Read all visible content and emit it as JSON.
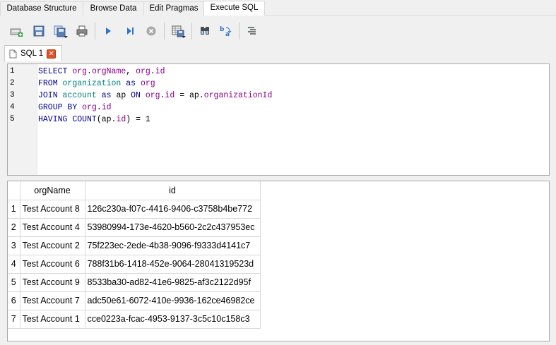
{
  "main_tabs": [
    {
      "label": "Database Structure",
      "active": false
    },
    {
      "label": "Browse Data",
      "active": false
    },
    {
      "label": "Edit Pragmas",
      "active": false
    },
    {
      "label": "Execute SQL",
      "active": true
    }
  ],
  "toolbar": {
    "icons": [
      "open-tab-icon",
      "open-sql-file-icon",
      "save-sql-file-icon",
      "print-icon",
      "execute-all-icon",
      "execute-line-icon",
      "stop-execution-icon",
      "save-results-icon",
      "find-icon",
      "find-replace-icon",
      "comment-icon"
    ]
  },
  "sql_tab": {
    "label": "SQL 1",
    "close_glyph": "✕"
  },
  "editor": {
    "line_numbers": [
      "1",
      "2",
      "3",
      "4",
      "5"
    ],
    "lines": [
      [
        {
          "t": "SELECT",
          "c": "kw"
        },
        {
          "t": " ",
          "c": "plain"
        },
        {
          "t": "org",
          "c": "col"
        },
        {
          "t": ".",
          "c": "plain"
        },
        {
          "t": "orgName",
          "c": "col"
        },
        {
          "t": ", ",
          "c": "plain"
        },
        {
          "t": "org",
          "c": "col"
        },
        {
          "t": ".",
          "c": "plain"
        },
        {
          "t": "id",
          "c": "col"
        }
      ],
      [
        {
          "t": "FROM",
          "c": "kw"
        },
        {
          "t": " ",
          "c": "plain"
        },
        {
          "t": "organization",
          "c": "tbl"
        },
        {
          "t": " ",
          "c": "plain"
        },
        {
          "t": "as",
          "c": "kw"
        },
        {
          "t": " ",
          "c": "plain"
        },
        {
          "t": "org",
          "c": "col"
        }
      ],
      [
        {
          "t": "JOIN",
          "c": "kw"
        },
        {
          "t": " ",
          "c": "plain"
        },
        {
          "t": "account",
          "c": "tbl"
        },
        {
          "t": " ",
          "c": "plain"
        },
        {
          "t": "as",
          "c": "kw"
        },
        {
          "t": " ap ",
          "c": "plain"
        },
        {
          "t": "ON",
          "c": "kw"
        },
        {
          "t": " ",
          "c": "plain"
        },
        {
          "t": "org",
          "c": "col"
        },
        {
          "t": ".",
          "c": "plain"
        },
        {
          "t": "id",
          "c": "col"
        },
        {
          "t": " = ap.",
          "c": "plain"
        },
        {
          "t": "organizationId",
          "c": "col"
        }
      ],
      [
        {
          "t": "GROUP",
          "c": "kw"
        },
        {
          "t": " ",
          "c": "plain"
        },
        {
          "t": "BY",
          "c": "kw"
        },
        {
          "t": " ",
          "c": "plain"
        },
        {
          "t": "org",
          "c": "col"
        },
        {
          "t": ".",
          "c": "plain"
        },
        {
          "t": "id",
          "c": "col"
        }
      ],
      [
        {
          "t": "HAVING",
          "c": "kw"
        },
        {
          "t": " ",
          "c": "plain"
        },
        {
          "t": "COUNT",
          "c": "kw"
        },
        {
          "t": "(ap.",
          "c": "plain"
        },
        {
          "t": "id",
          "c": "col"
        },
        {
          "t": ") = 1",
          "c": "plain"
        }
      ]
    ]
  },
  "results": {
    "columns": [
      "orgName",
      "id"
    ],
    "rows": [
      {
        "n": "1",
        "orgName": "Test Account 8",
        "id": "126c230a-f07c-4416-9406-c3758b4be772"
      },
      {
        "n": "2",
        "orgName": "Test Account 4",
        "id": "53980994-173e-4620-b560-2c2c437953ec"
      },
      {
        "n": "3",
        "orgName": "Test Account 2",
        "id": "75f223ec-2ede-4b38-9096-f9333d4141c7"
      },
      {
        "n": "4",
        "orgName": "Test Account 6",
        "id": "788f31b6-1418-452e-9064-28041319523d"
      },
      {
        "n": "5",
        "orgName": "Test Account 9",
        "id": "8533ba30-ad82-41e6-9825-af3c2122d95f"
      },
      {
        "n": "6",
        "orgName": "Test Account 7",
        "id": "adc50e61-6072-410e-9936-162ce46982ce"
      },
      {
        "n": "7",
        "orgName": "Test Account 1",
        "id": "cce0223a-fcac-4953-9137-3c5c10c158c3"
      }
    ]
  }
}
